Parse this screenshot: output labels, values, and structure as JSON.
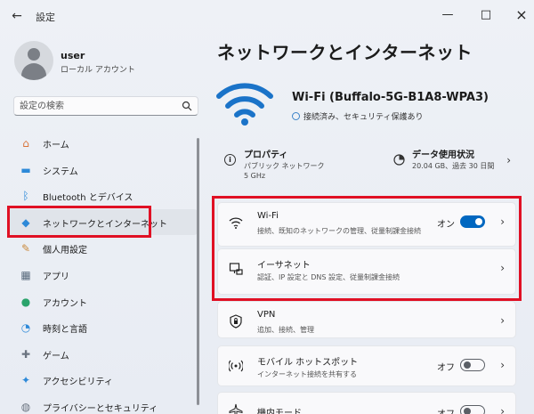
{
  "window": {
    "title": "設定",
    "back_icon": "←",
    "min_icon": "—",
    "max_icon": "□",
    "close_icon": "×"
  },
  "user": {
    "name": "user",
    "account_type": "ローカル アカウント"
  },
  "search": {
    "placeholder": "設定の検索"
  },
  "sidebar": {
    "items": [
      {
        "label": "ホーム",
        "icon": "home-icon",
        "glyph": "⌂",
        "color": "#d9743a"
      },
      {
        "label": "システム",
        "icon": "system-icon",
        "glyph": "▬",
        "color": "#2d89d8"
      },
      {
        "label": "Bluetooth とデバイス",
        "icon": "bluetooth-icon",
        "glyph": "ᛒ",
        "color": "#2d89d8"
      },
      {
        "label": "ネットワークとインターネット",
        "icon": "network-icon",
        "glyph": "◆",
        "color": "#2d89d8",
        "selected": true
      },
      {
        "label": "個人用設定",
        "icon": "personalize-icon",
        "glyph": "✎",
        "color": "#c98a3c"
      },
      {
        "label": "アプリ",
        "icon": "apps-icon",
        "glyph": "▦",
        "color": "#5a6b7d"
      },
      {
        "label": "アカウント",
        "icon": "account-icon",
        "glyph": "●",
        "color": "#2aa36b"
      },
      {
        "label": "時刻と言語",
        "icon": "time-language-icon",
        "glyph": "◔",
        "color": "#2d89d8"
      },
      {
        "label": "ゲーム",
        "icon": "gaming-icon",
        "glyph": "✚",
        "color": "#6b7480"
      },
      {
        "label": "アクセシビリティ",
        "icon": "accessibility-icon",
        "glyph": "✦",
        "color": "#2d89d8"
      },
      {
        "label": "プライバシーとセキュリティ",
        "icon": "privacy-icon",
        "glyph": "◍",
        "color": "#6b7480"
      }
    ]
  },
  "main": {
    "title": "ネットワークとインターネット",
    "network_name": "Wi-Fi (Buffalo-5G-B1A8-WPA3)",
    "network_status": "接続済み、セキュリティ保護あり",
    "properties": {
      "title": "プロパティ",
      "sub1": "パブリック ネットワーク",
      "sub2": "5 GHz",
      "data_title": "データ使用状況",
      "data_sub": "20.04 GB、過去 30 日間"
    },
    "cards": [
      {
        "title": "Wi-Fi",
        "subtitle": "接続、既知のネットワークの管理、従量制課金接続",
        "toggle_label": "オン",
        "toggle": true,
        "icon": "wifi-icon"
      },
      {
        "title": "イーサネット",
        "subtitle": "認証、IP 設定と DNS 設定、従量制課金接続",
        "icon": "ethernet-icon"
      },
      {
        "title": "VPN",
        "subtitle": "追加、接続、管理",
        "icon": "vpn-shield-icon"
      },
      {
        "title": "モバイル ホットスポット",
        "subtitle": "インターネット接続を共有する",
        "toggle_label": "オフ",
        "toggle": false,
        "icon": "hotspot-icon"
      },
      {
        "title": "機内モード",
        "subtitle": "",
        "toggle_label": "オフ",
        "toggle": false,
        "icon": "airplane-icon"
      }
    ],
    "chevron": "›"
  },
  "colors": {
    "accent": "#0067c0",
    "highlight": "#e01024",
    "wifi_icon": "#1a73c8"
  }
}
